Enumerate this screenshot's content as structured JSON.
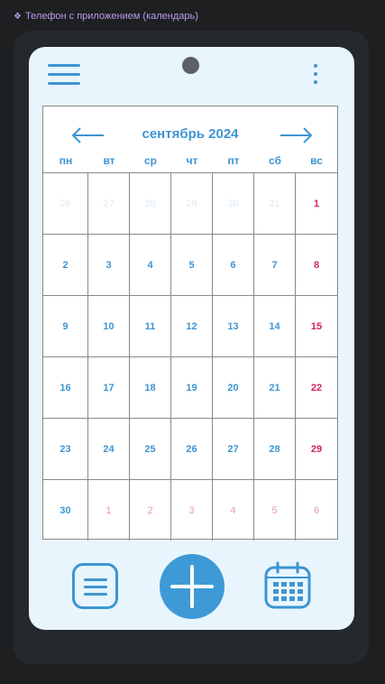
{
  "frame": {
    "label": "Телефон с приложением (календарь)"
  },
  "calendar": {
    "month_title": "сентябрь 2024",
    "weekdays": [
      "пн",
      "вт",
      "ср",
      "чт",
      "пт",
      "сб",
      "вс"
    ],
    "weeks": [
      [
        {
          "day": "26",
          "state": "prev-month"
        },
        {
          "day": "27",
          "state": "prev-month"
        },
        {
          "day": "28",
          "state": "prev-month"
        },
        {
          "day": "29",
          "state": "prev-month"
        },
        {
          "day": "30",
          "state": "prev-month"
        },
        {
          "day": "31",
          "state": "prev-month"
        },
        {
          "day": "1",
          "state": "sunday"
        }
      ],
      [
        {
          "day": "2",
          "state": "normal"
        },
        {
          "day": "3",
          "state": "normal"
        },
        {
          "day": "4",
          "state": "normal"
        },
        {
          "day": "5",
          "state": "normal"
        },
        {
          "day": "6",
          "state": "normal"
        },
        {
          "day": "7",
          "state": "normal"
        },
        {
          "day": "8",
          "state": "sunday"
        }
      ],
      [
        {
          "day": "9",
          "state": "normal"
        },
        {
          "day": "10",
          "state": "normal"
        },
        {
          "day": "11",
          "state": "normal"
        },
        {
          "day": "12",
          "state": "normal"
        },
        {
          "day": "13",
          "state": "normal"
        },
        {
          "day": "14",
          "state": "normal"
        },
        {
          "day": "15",
          "state": "sunday"
        }
      ],
      [
        {
          "day": "16",
          "state": "normal"
        },
        {
          "day": "17",
          "state": "normal"
        },
        {
          "day": "18",
          "state": "normal"
        },
        {
          "day": "19",
          "state": "normal"
        },
        {
          "day": "20",
          "state": "normal"
        },
        {
          "day": "21",
          "state": "normal"
        },
        {
          "day": "22",
          "state": "sunday"
        }
      ],
      [
        {
          "day": "23",
          "state": "normal"
        },
        {
          "day": "24",
          "state": "normal"
        },
        {
          "day": "25",
          "state": "normal"
        },
        {
          "day": "26",
          "state": "normal"
        },
        {
          "day": "27",
          "state": "normal"
        },
        {
          "day": "28",
          "state": "normal"
        },
        {
          "day": "29",
          "state": "sunday"
        }
      ],
      [
        {
          "day": "30",
          "state": "normal"
        },
        {
          "day": "1",
          "state": "next-month"
        },
        {
          "day": "2",
          "state": "next-month"
        },
        {
          "day": "3",
          "state": "next-month"
        },
        {
          "day": "4",
          "state": "next-month"
        },
        {
          "day": "5",
          "state": "next-month"
        },
        {
          "day": "6",
          "state": "next-month"
        }
      ]
    ]
  },
  "icons": {
    "menu": "hamburger-menu-icon",
    "more": "kebab-more-icon",
    "prev": "arrow-left-icon",
    "next": "arrow-right-icon",
    "list": "list-icon",
    "add": "plus-icon",
    "calendar": "calendar-icon"
  },
  "colors": {
    "accent": "#3d95d1",
    "sunday": "#d2245a",
    "screen_bg": "#e8f5fd",
    "phone_bg": "#24292e",
    "canvas_bg": "#1e1f21"
  }
}
